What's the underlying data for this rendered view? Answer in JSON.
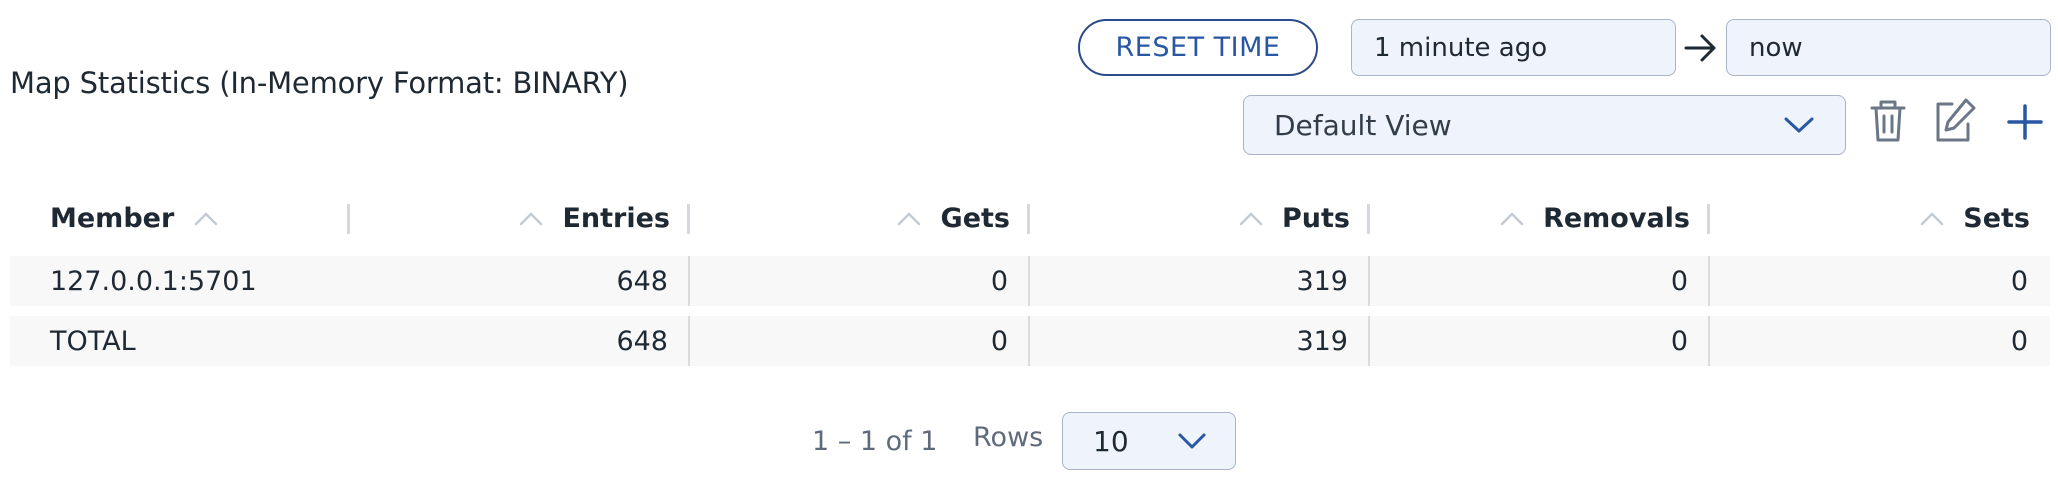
{
  "header": {
    "title": "Map Statistics (In-Memory Format: BINARY)",
    "reset_time_label": "RESET TIME",
    "time_from": "1 minute ago",
    "time_to": "now",
    "view": "Default View"
  },
  "table": {
    "columns": [
      "Member",
      "Entries",
      "Gets",
      "Puts",
      "Removals",
      "Sets"
    ],
    "rows": [
      [
        "127.0.0.1:5701",
        "648",
        "0",
        "319",
        "0",
        "0"
      ],
      [
        "TOTAL",
        "648",
        "0",
        "319",
        "0",
        "0"
      ]
    ]
  },
  "pagination": {
    "range": "1 – 1 of 1",
    "rows_label": "Rows",
    "rows_per_page": "10"
  },
  "colors": {
    "accent": "#2957a4",
    "field_bg": "#eef3fc",
    "row_bg": "#f8f8f8"
  },
  "icons": [
    "arrow-right-icon",
    "chevron-down-icon",
    "trash-icon",
    "edit-icon",
    "plus-icon",
    "sort-asc-icon"
  ]
}
